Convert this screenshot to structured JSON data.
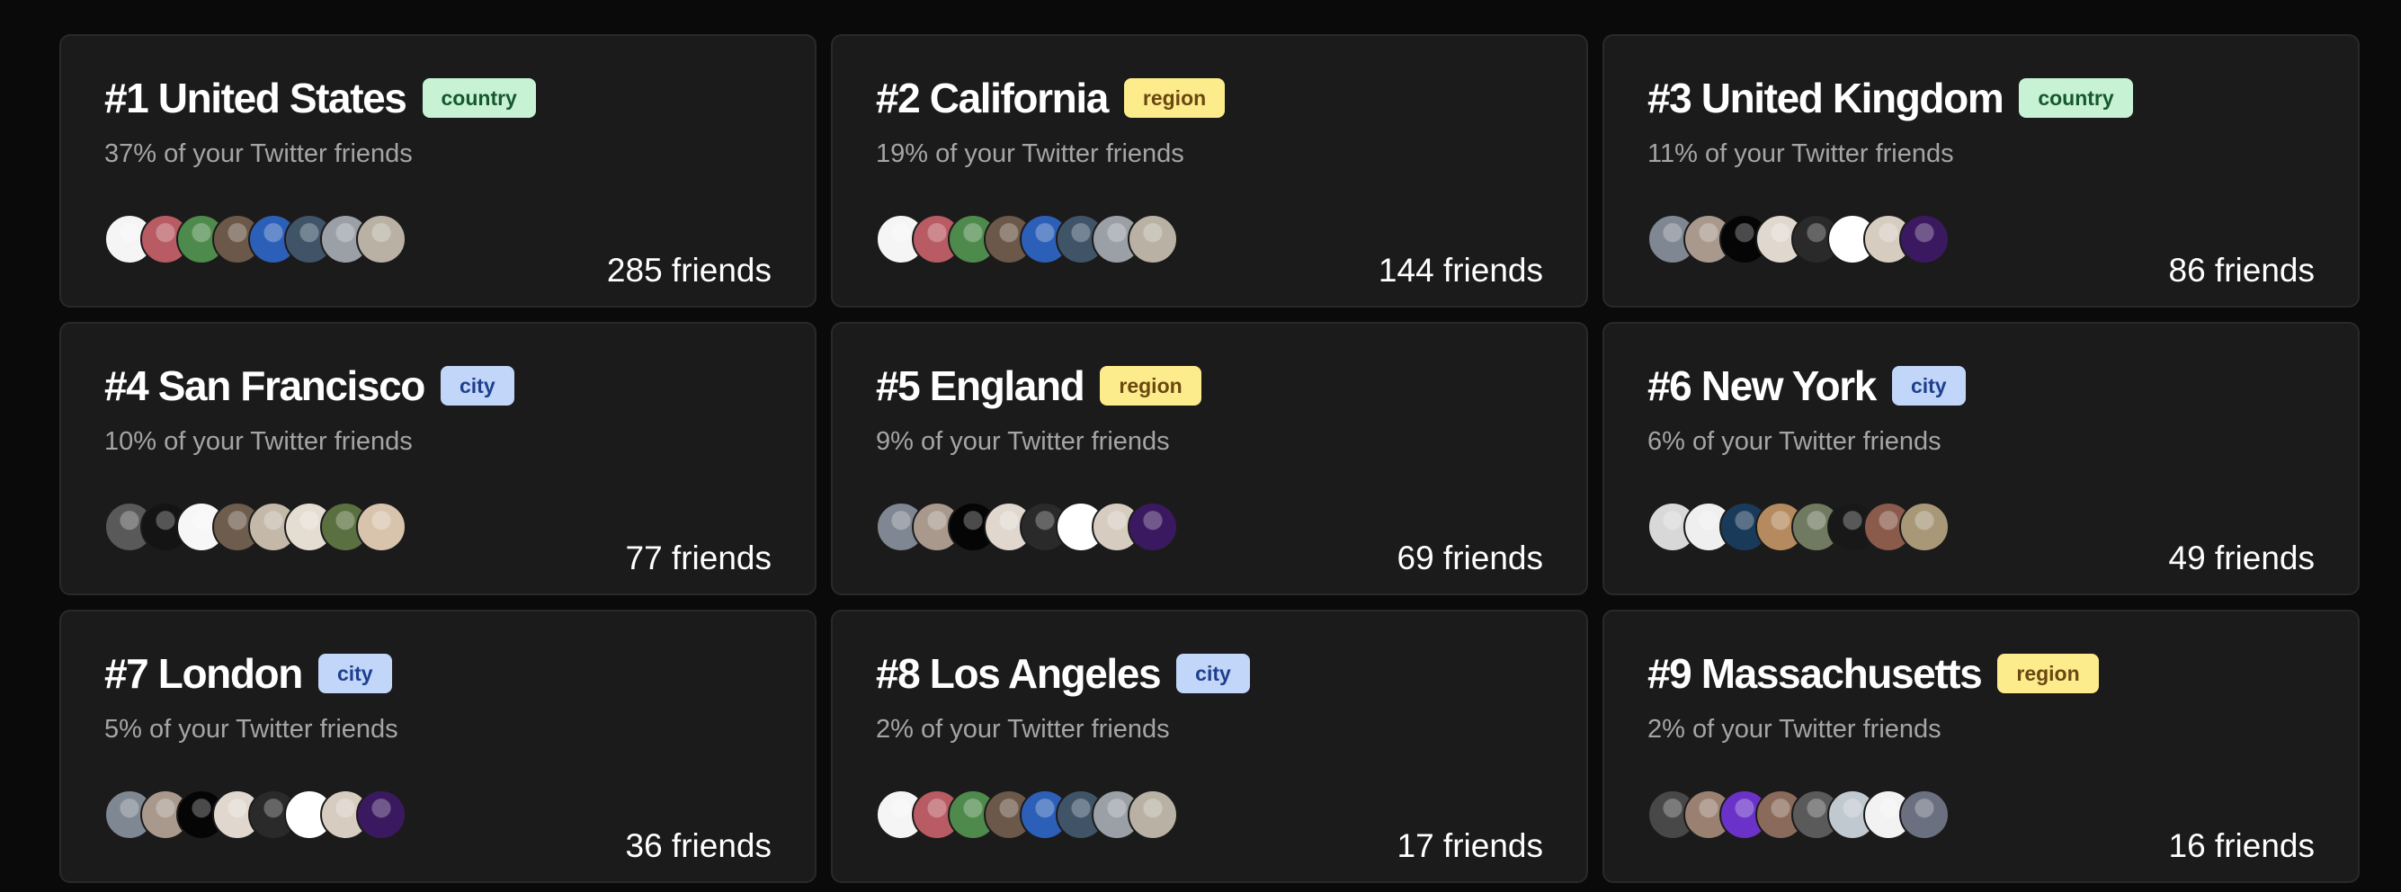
{
  "cards": [
    {
      "title": "#1 United States",
      "badge": "country",
      "badge_kind": "country",
      "pct": "37% of your Twitter friends",
      "friends": "285 friends",
      "avatars": [
        "#f5f5f5",
        "#b85b63",
        "#4e8a4c",
        "#6b5848",
        "#2c5fb8",
        "#405468",
        "#9aa0a6",
        "#b8b1a4"
      ]
    },
    {
      "title": "#2 California",
      "badge": "region",
      "badge_kind": "region",
      "pct": "19% of your Twitter friends",
      "friends": "144 friends",
      "avatars": [
        "#f5f5f5",
        "#b85b63",
        "#4e8a4c",
        "#6b5848",
        "#2c5fb8",
        "#405468",
        "#9aa0a6",
        "#b8b1a4"
      ]
    },
    {
      "title": "#3 United Kingdom",
      "badge": "country",
      "badge_kind": "country",
      "pct": "11% of your Twitter friends",
      "friends": "86 friends",
      "avatars": [
        "#7f8792",
        "#a8998c",
        "#050505",
        "#e0d8cf",
        "#2a2a2a",
        "#ffffff",
        "#d7ccc0",
        "#3b1960"
      ]
    },
    {
      "title": "#4 San Francisco",
      "badge": "city",
      "badge_kind": "city",
      "pct": "10% of your Twitter friends",
      "friends": "77 friends",
      "avatars": [
        "#595959",
        "#141414",
        "#f7f7f7",
        "#6e5c4d",
        "#c4b8a8",
        "#e5ddd2",
        "#5a7040",
        "#d8c3ad"
      ]
    },
    {
      "title": "#5 England",
      "badge": "region",
      "badge_kind": "region",
      "pct": "9% of your Twitter friends",
      "friends": "69 friends",
      "avatars": [
        "#7f8792",
        "#a8998c",
        "#050505",
        "#e0d8cf",
        "#2a2a2a",
        "#ffffff",
        "#d7ccc0",
        "#3b1960"
      ]
    },
    {
      "title": "#6 New York",
      "badge": "city",
      "badge_kind": "city",
      "pct": "6% of your Twitter friends",
      "friends": "49 friends",
      "avatars": [
        "#d8d8d8",
        "#efefef",
        "#1a3a5a",
        "#b48a5e",
        "#707a60",
        "#181818",
        "#8a5a4a",
        "#a89878"
      ]
    },
    {
      "title": "#7 London",
      "badge": "city",
      "badge_kind": "city",
      "pct": "5% of your Twitter friends",
      "friends": "36 friends",
      "avatars": [
        "#7f8792",
        "#a8998c",
        "#050505",
        "#e0d8cf",
        "#2a2a2a",
        "#ffffff",
        "#d7ccc0",
        "#3b1960"
      ]
    },
    {
      "title": "#8 Los Angeles",
      "badge": "city",
      "badge_kind": "city",
      "pct": "2% of your Twitter friends",
      "friends": "17 friends",
      "avatars": [
        "#f5f5f5",
        "#b85b63",
        "#4e8a4c",
        "#6b5848",
        "#2c5fb8",
        "#405468",
        "#9aa0a6",
        "#b8b1a4"
      ]
    },
    {
      "title": "#9 Massachusetts",
      "badge": "region",
      "badge_kind": "region",
      "pct": "2% of your Twitter friends",
      "friends": "16 friends",
      "avatars": [
        "#484848",
        "#9a8070",
        "#6a32c8",
        "#8a6a5a",
        "#5a5a5a",
        "#c0c8d0",
        "#f2f2f2",
        "#6a7080"
      ]
    }
  ]
}
